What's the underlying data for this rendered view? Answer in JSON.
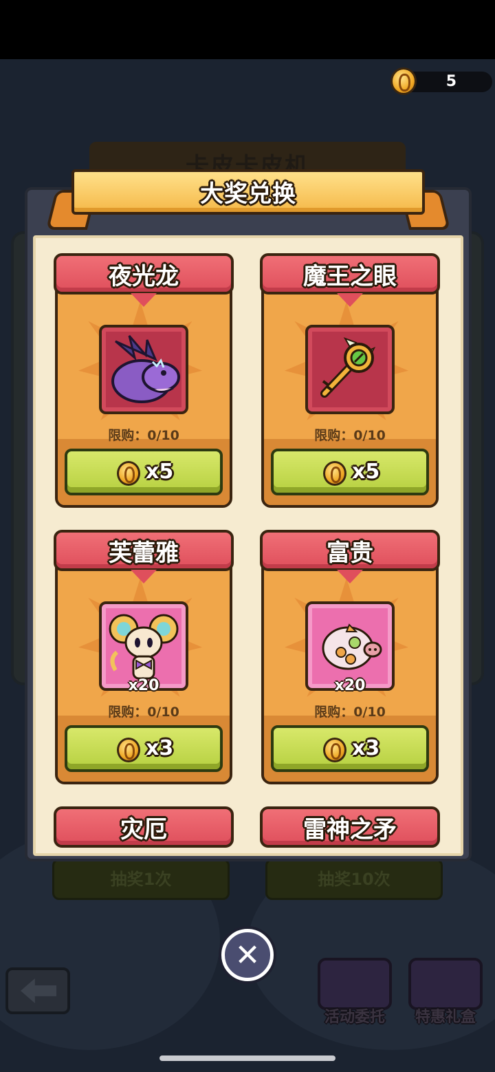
{
  "currency": {
    "count": "5",
    "icon": "gold-coin-icon"
  },
  "background": {
    "title": "卡皮卡皮机",
    "draw_once_label": "抽奖1次",
    "draw_ten_label": "抽奖10次",
    "task_label": "活动委托",
    "gift_label": "特惠礼盒"
  },
  "modal": {
    "title": "大奖兑换",
    "items": [
      {
        "name": "夜光龙",
        "limit": "限购：0/10",
        "price": "x5",
        "qty": "",
        "frame": "red",
        "icon": "dragon-icon"
      },
      {
        "name": "魔王之眼",
        "limit": "限购：0/10",
        "price": "x5",
        "qty": "",
        "frame": "red",
        "icon": "eye-key-icon"
      },
      {
        "name": "芙蕾雅",
        "limit": "限购：0/10",
        "price": "x3",
        "qty": "x20",
        "frame": "pink",
        "icon": "mouse-pet-icon"
      },
      {
        "name": "富贵",
        "limit": "限购：0/10",
        "price": "x3",
        "qty": "x20",
        "frame": "pink",
        "icon": "piggy-icon"
      },
      {
        "name": "灾厄",
        "limit": "",
        "price": "",
        "qty": "",
        "frame": "red",
        "icon": ""
      },
      {
        "name": "雷神之矛",
        "limit": "",
        "price": "",
        "qty": "",
        "frame": "red",
        "icon": ""
      }
    ]
  },
  "close_icon": "close-icon",
  "back_icon": "back-arrow-icon",
  "colors": {
    "card_header": "#df4f5c",
    "card_body": "#f0a64a",
    "buy_button": "#b6d040",
    "modal_bg": "#f6ebd0"
  }
}
